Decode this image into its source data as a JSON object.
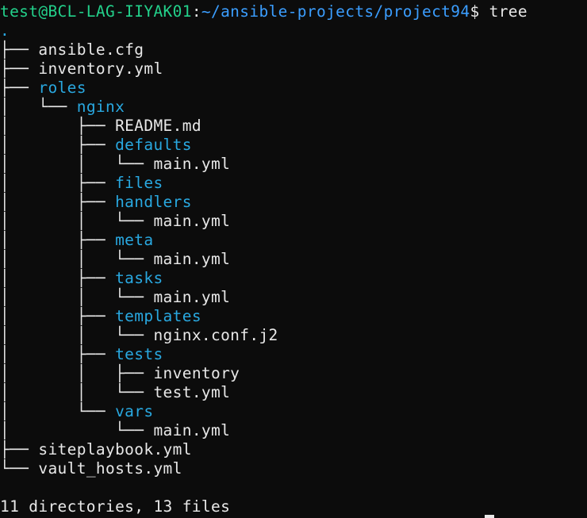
{
  "prompt": {
    "user_host": "test@BCL-LAG-IIYAK01",
    "separator": ":",
    "path": "~/ansible-projects/project94",
    "symbol": "$ ",
    "command": "tree"
  },
  "tree": {
    "root": ".",
    "lines": [
      {
        "prefix": "├── ",
        "name": "ansible.cfg",
        "kind": "file"
      },
      {
        "prefix": "├── ",
        "name": "inventory.yml",
        "kind": "file"
      },
      {
        "prefix": "├── ",
        "name": "roles",
        "kind": "dir"
      },
      {
        "prefix": "│   └── ",
        "name": "nginx",
        "kind": "dir"
      },
      {
        "prefix": "│       ├── ",
        "name": "README.md",
        "kind": "file"
      },
      {
        "prefix": "│       ├── ",
        "name": "defaults",
        "kind": "dir"
      },
      {
        "prefix": "│       │   └── ",
        "name": "main.yml",
        "kind": "file"
      },
      {
        "prefix": "│       ├── ",
        "name": "files",
        "kind": "dir"
      },
      {
        "prefix": "│       ├── ",
        "name": "handlers",
        "kind": "dir"
      },
      {
        "prefix": "│       │   └── ",
        "name": "main.yml",
        "kind": "file"
      },
      {
        "prefix": "│       ├── ",
        "name": "meta",
        "kind": "dir"
      },
      {
        "prefix": "│       │   └── ",
        "name": "main.yml",
        "kind": "file"
      },
      {
        "prefix": "│       ├── ",
        "name": "tasks",
        "kind": "dir"
      },
      {
        "prefix": "│       │   └── ",
        "name": "main.yml",
        "kind": "file"
      },
      {
        "prefix": "│       ├── ",
        "name": "templates",
        "kind": "dir"
      },
      {
        "prefix": "│       │   └── ",
        "name": "nginx.conf.j2",
        "kind": "file"
      },
      {
        "prefix": "│       ├── ",
        "name": "tests",
        "kind": "dir"
      },
      {
        "prefix": "│       │   ├── ",
        "name": "inventory",
        "kind": "file"
      },
      {
        "prefix": "│       │   └── ",
        "name": "test.yml",
        "kind": "file"
      },
      {
        "prefix": "│       └── ",
        "name": "vars",
        "kind": "dir"
      },
      {
        "prefix": "│           └── ",
        "name": "main.yml",
        "kind": "file"
      },
      {
        "prefix": "├── ",
        "name": "siteplaybook.yml",
        "kind": "file"
      },
      {
        "prefix": "└── ",
        "name": "vault_hosts.yml",
        "kind": "file"
      }
    ]
  },
  "summary": "11 directories, 13 files",
  "colors": {
    "background": "#0c0c0c",
    "prompt_user": "#23d18b",
    "prompt_path": "#3b9eff",
    "directory": "#29a8e0",
    "text": "#e8e8e8"
  }
}
